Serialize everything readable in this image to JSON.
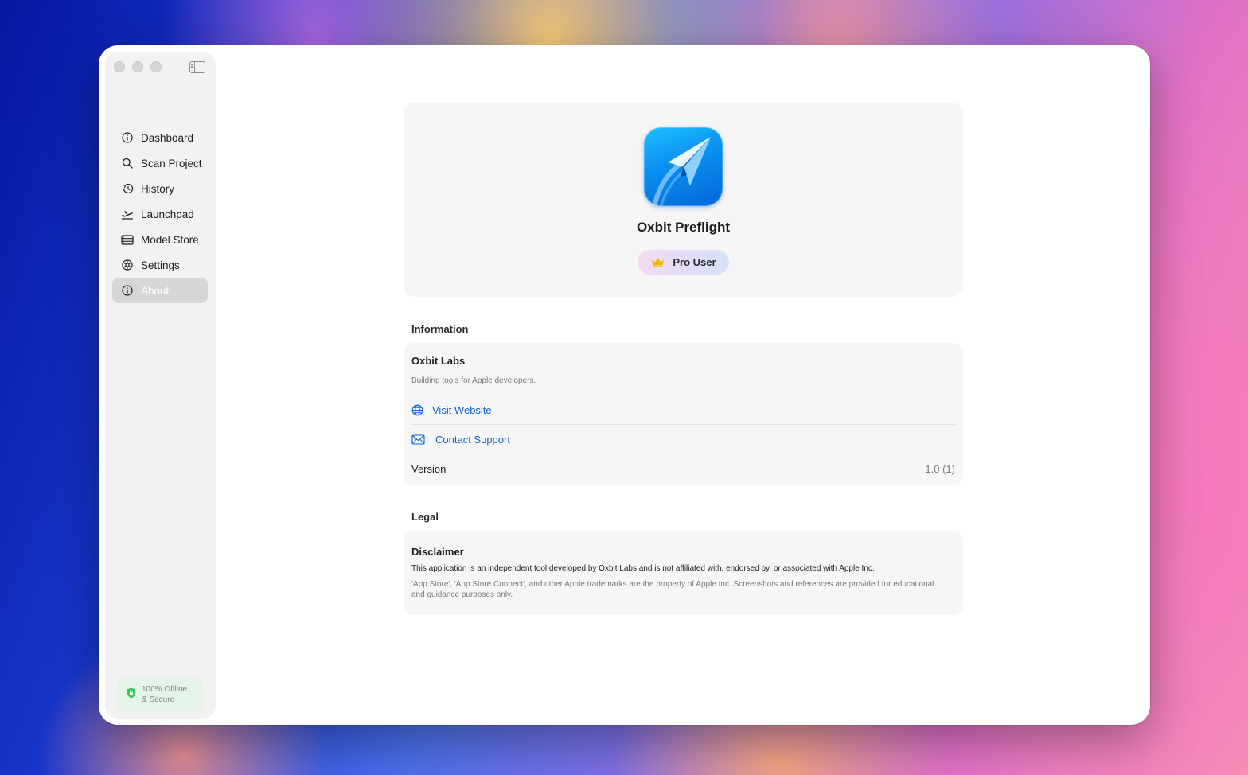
{
  "sidebar": {
    "items": [
      {
        "label": "Dashboard",
        "icon": "dashboard-icon"
      },
      {
        "label": "Scan Project",
        "icon": "search-icon"
      },
      {
        "label": "History",
        "icon": "history-icon"
      },
      {
        "label": "Launchpad",
        "icon": "airplane-takeoff-icon"
      },
      {
        "label": "Model Store",
        "icon": "model-store-icon"
      },
      {
        "label": "Settings",
        "icon": "gear-icon"
      },
      {
        "label": "About",
        "icon": "info-icon"
      }
    ],
    "active_item": "About",
    "secure_badge": "100% Offline & Secure"
  },
  "about": {
    "app_name": "Oxbit Preflight",
    "badge_label": "Pro User",
    "information_heading": "Information",
    "org_name": "Oxbit Labs",
    "org_description": "Building tools for Apple developers.",
    "visit_website": "Visit Website",
    "contact_support": "Contact Support",
    "version_label": "Version",
    "version_value": "1.0 (1)",
    "legal_heading": "Legal",
    "disclaimer_title": "Disclaimer",
    "disclaimer_text": "This application is an independent tool developed by Oxbit Labs and is not affiliated with, endorsed by, or associated with Apple Inc.",
    "disclaimer_note": "'App Store', 'App Store Connect', and other Apple trademarks are the property of Apple Inc. Screenshots and references are provided for educational and guidance purposes only."
  },
  "colors": {
    "accent_link": "#0a63c9",
    "secure_badge_bg": "#e6f3e9",
    "secure_icon": "#34c759",
    "crown": "#f5b800"
  }
}
